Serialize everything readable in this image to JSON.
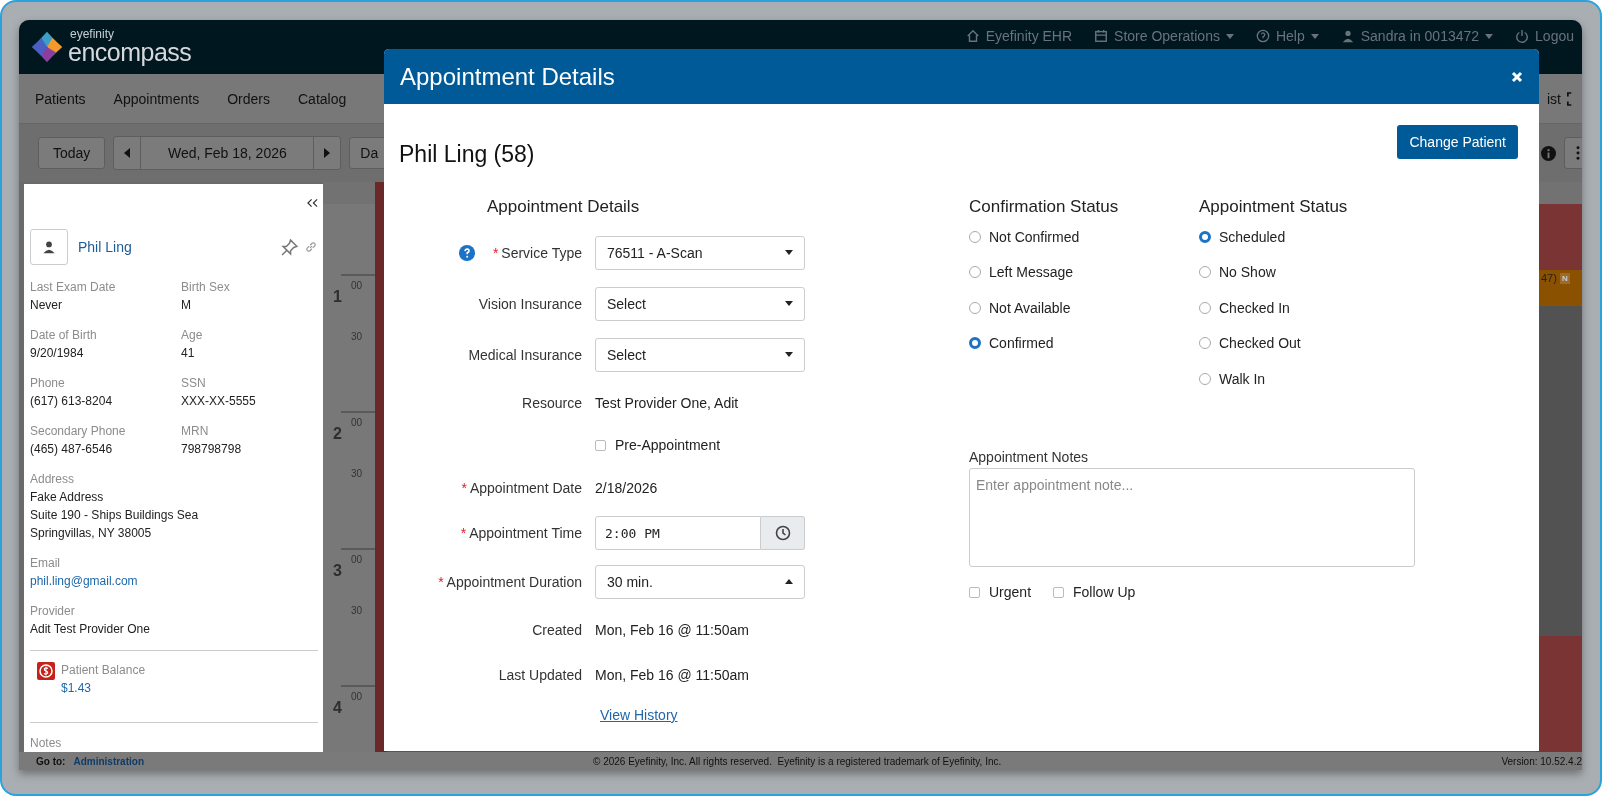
{
  "header": {
    "brand_small": "eyefinity",
    "brand": "encompass",
    "links": [
      {
        "label": "Eyefinity EHR",
        "dropdown": false
      },
      {
        "label": "Store Operations",
        "dropdown": true
      },
      {
        "label": "Help",
        "dropdown": true
      },
      {
        "label": "Sandra in 0013472",
        "dropdown": true
      },
      {
        "label": "Logou",
        "dropdown": false
      }
    ]
  },
  "nav": {
    "items": [
      "Patients",
      "Appointments",
      "Orders",
      "Catalog"
    ],
    "cut_item": "ist"
  },
  "toolbar": {
    "today": "Today",
    "date": "Wed, Feb 18, 2026",
    "view": "Da"
  },
  "calendar": {
    "hours": [
      {
        "hour": "1",
        "marks": [
          "00",
          "30"
        ]
      },
      {
        "hour": "2",
        "marks": [
          "00",
          "30"
        ]
      },
      {
        "hour": "3",
        "marks": [
          "00",
          "30"
        ]
      },
      {
        "hour": "4",
        "marks": [
          "00"
        ]
      }
    ],
    "event": {
      "text": "47)",
      "badge": "N"
    }
  },
  "patient_panel": {
    "name": "Phil Ling",
    "fields": [
      {
        "label": "Last Exam Date",
        "value": "Never"
      },
      {
        "label": "Birth Sex",
        "value": "M"
      },
      {
        "label": "Date of Birth",
        "value": "9/20/1984"
      },
      {
        "label": "Age",
        "value": "41"
      },
      {
        "label": "Phone",
        "value": "(617) 613-8204"
      },
      {
        "label": "SSN",
        "value": "XXX-XX-5555"
      },
      {
        "label": "Secondary Phone",
        "value": "(465) 487-6546"
      },
      {
        "label": "MRN",
        "value": "798798798"
      }
    ],
    "address": {
      "label": "Address",
      "lines": [
        "Fake Address",
        "Suite 190 - Ships Buildings Sea",
        "Springvillas, NY 38005"
      ]
    },
    "email": {
      "label": "Email",
      "value": "phil.ling@gmail.com"
    },
    "provider": {
      "label": "Provider",
      "value": "Adit Test Provider One"
    },
    "balance": {
      "label": "Patient Balance",
      "value": "$1.43"
    },
    "notes_label": "Notes"
  },
  "modal": {
    "title": "Appointment Details",
    "patient": "Phil Ling (58)",
    "change_button": "Change Patient",
    "form_title": "Appointment Details",
    "required_mark": "*",
    "fields": [
      {
        "kind": "select",
        "label": "Service Type",
        "required": true,
        "help": true,
        "value": "76511 - A-Scan",
        "expanded": false
      },
      {
        "kind": "select",
        "label": "Vision Insurance",
        "required": false,
        "value": "Select",
        "expanded": false
      },
      {
        "kind": "select",
        "label": "Medical Insurance",
        "required": false,
        "value": "Select",
        "expanded": false
      },
      {
        "kind": "static",
        "label": "Resource",
        "required": false,
        "value": "Test Provider One, Adit"
      },
      {
        "kind": "checkbox",
        "label": "Pre-Appointment",
        "checked": false
      },
      {
        "kind": "static",
        "label": "Appointment Date",
        "required": true,
        "value": "2/18/2026"
      },
      {
        "kind": "time",
        "label": "Appointment Time",
        "required": true,
        "value": "2:00 PM"
      },
      {
        "kind": "select",
        "label": "Appointment Duration",
        "required": true,
        "value": "30 min.",
        "expanded": true
      },
      {
        "kind": "static",
        "label": "Created",
        "required": false,
        "value": "Mon, Feb 16 @ 11:50am"
      },
      {
        "kind": "static",
        "label": "Last Updated",
        "required": false,
        "value": "Mon, Feb 16 @ 11:50am"
      },
      {
        "kind": "link",
        "label": "View History"
      }
    ],
    "confirmation": {
      "title": "Confirmation Status",
      "options": [
        {
          "label": "Not Confirmed",
          "selected": false
        },
        {
          "label": "Left Message",
          "selected": false
        },
        {
          "label": "Not Available",
          "selected": false
        },
        {
          "label": "Confirmed",
          "selected": true
        }
      ]
    },
    "appointment_status": {
      "title": "Appointment Status",
      "options": [
        {
          "label": "Scheduled",
          "selected": true
        },
        {
          "label": "No Show",
          "selected": false
        },
        {
          "label": "Checked In",
          "selected": false
        },
        {
          "label": "Checked Out",
          "selected": false
        },
        {
          "label": "Walk In",
          "selected": false
        }
      ]
    },
    "notes": {
      "label": "Appointment Notes",
      "placeholder": "Enter appointment note..."
    },
    "flags": [
      {
        "label": "Urgent",
        "checked": false
      },
      {
        "label": "Follow Up",
        "checked": false
      }
    ]
  },
  "footer": {
    "goto_label": "Go to:",
    "goto_link": "Administration",
    "copyright": "© 2026 Eyefinity, Inc. All rights reserved.  Eyefinity is a registered trademark of Eyefinity, Inc.",
    "version": "Version: 10.52.4.2"
  }
}
